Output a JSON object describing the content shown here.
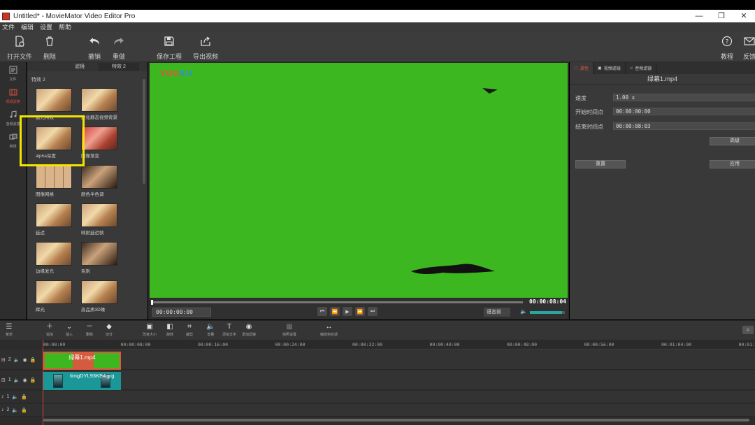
{
  "window": {
    "title": "Untitled* - MovieMator Video Editor Pro"
  },
  "menu": [
    "文件",
    "编辑",
    "设置",
    "帮助"
  ],
  "toolbar": {
    "open": "打开文件",
    "delete": "删除",
    "undo": "撤销",
    "redo": "重做",
    "save": "保存工程",
    "export": "导出视频",
    "tutorial": "教程",
    "feedback": "反馈"
  },
  "leftnav": [
    "文件",
    "视频滤镜",
    "音频滤镜",
    "转场"
  ],
  "effects": {
    "tab1": "滤镜",
    "tab2": "特效 2",
    "group": "特效 2",
    "items": [
      {
        "label": "遮光特效",
        "style": ""
      },
      {
        "label": "虚化静态视频背景",
        "style": ""
      },
      {
        "label": "alpha深度",
        "style": ""
      },
      {
        "label": "图像渐变",
        "style": "red"
      },
      {
        "label": "图像网格",
        "style": "grid4"
      },
      {
        "label": "颜色半色调",
        "style": "dark"
      },
      {
        "label": "延迟",
        "style": ""
      },
      {
        "label": "映射延迟帧",
        "style": ""
      },
      {
        "label": "边缘发光",
        "style": ""
      },
      {
        "label": "毛刺",
        "style": "dark"
      },
      {
        "label": "辉光",
        "style": ""
      },
      {
        "label": "高品质3D噪",
        "style": ""
      }
    ]
  },
  "preview": {
    "watermark_a": "YOU",
    "watermark_b": "KU",
    "total_time": "00:00:08:04",
    "current_time": "00:00:00:00",
    "language": "语言前",
    "volume_level": 0.92,
    "accent": "#3db71f"
  },
  "props": {
    "tab1": "属性",
    "tab2": "视频滤镜",
    "tab3": "音频滤镜",
    "file": "绿幕1.mp4",
    "speed_label": "速度",
    "speed_value": "1.00 x",
    "start_label": "开始时间点",
    "start_value": "00:00:00:00",
    "end_label": "结束时间点",
    "end_value": "00:00:08:03",
    "advanced": "高级",
    "reset": "重置",
    "apply": "应用"
  },
  "timeline_tools": [
    "菜单",
    "追加",
    "插入",
    "删除",
    "切分",
    "改变大小",
    "旋转",
    "裁剪",
    "音量",
    "添加文字",
    "添加滤镜",
    "快照设置",
    "缩放到合适"
  ],
  "ruler": [
    "00:00:00",
    "00:00:08:00",
    "00:00:16:00",
    "00:00:24:00",
    "00:00:32:00",
    "00:00:40:00",
    "00:00:48:00",
    "00:00:56:00",
    "00:01:04:00",
    "00:01:1"
  ],
  "tracks": {
    "v2": "2",
    "v1": "1",
    "a1": "1",
    "a2": "2",
    "clip_v2": "绿幕1.mp4",
    "clip_v1": "timgDYL93KE4.jpg"
  }
}
